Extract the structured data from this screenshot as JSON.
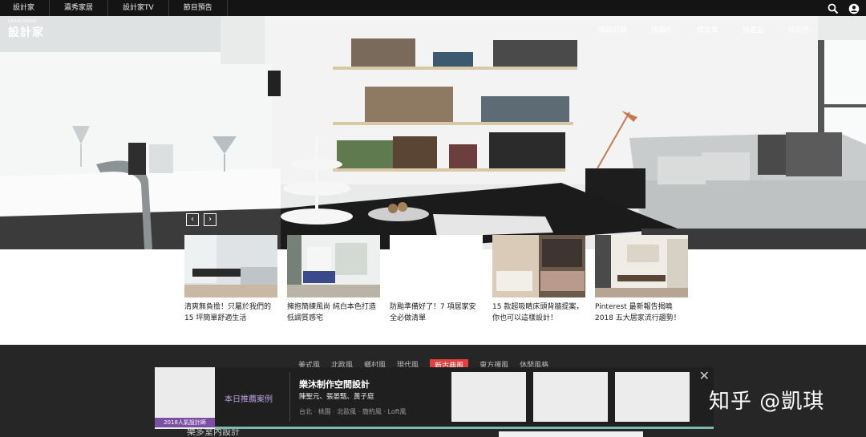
{
  "topbar": {
    "tabs": [
      "設計家",
      "瀛秀家居",
      "設計家TV",
      "節目預告"
    ]
  },
  "logo": {
    "small": "SEARCHOME",
    "big": "設計家"
  },
  "nav": {
    "items": [
      "找設計師",
      "找圖片",
      "找文章",
      "找產品",
      "找影片",
      "",
      ""
    ]
  },
  "cards": [
    {
      "caption": "清爽無負擔！只屬於我們的 15 坪簡單舒適生活"
    },
    {
      "caption": "擁抱簡練風尚 純白本色打造低調質感宅"
    },
    {
      "caption": "防颱準備好了！7 項居家安全必做清單"
    },
    {
      "caption": "15 款超吸睛床頭背牆提案，你也可以這樣設計！"
    },
    {
      "caption": "Pinterest 最新報告揭曉 2018 五大居家流行趨勢！"
    }
  ],
  "style_tabs": [
    "美式風",
    "北歐風",
    "鄉村風",
    "現代風",
    "新古典風",
    "東方禪風",
    "休閒風格"
  ],
  "partial_name": "樂多室內設計",
  "popup": {
    "label": "本日推薦案例",
    "badge": "2018人氣設計師",
    "title": "樂沐制作空間設計",
    "names": "陳聖元、張晏甄、黃子庭",
    "tags": "台北 · 桃園 · 北歐風 · 簡約風 · Loft風",
    "close": "✕"
  },
  "watermark": "知乎 @凱琪",
  "colors": {
    "accent_red": "#e0413f",
    "purple": "#7b4fa3",
    "teal": "#4fd3c7"
  }
}
